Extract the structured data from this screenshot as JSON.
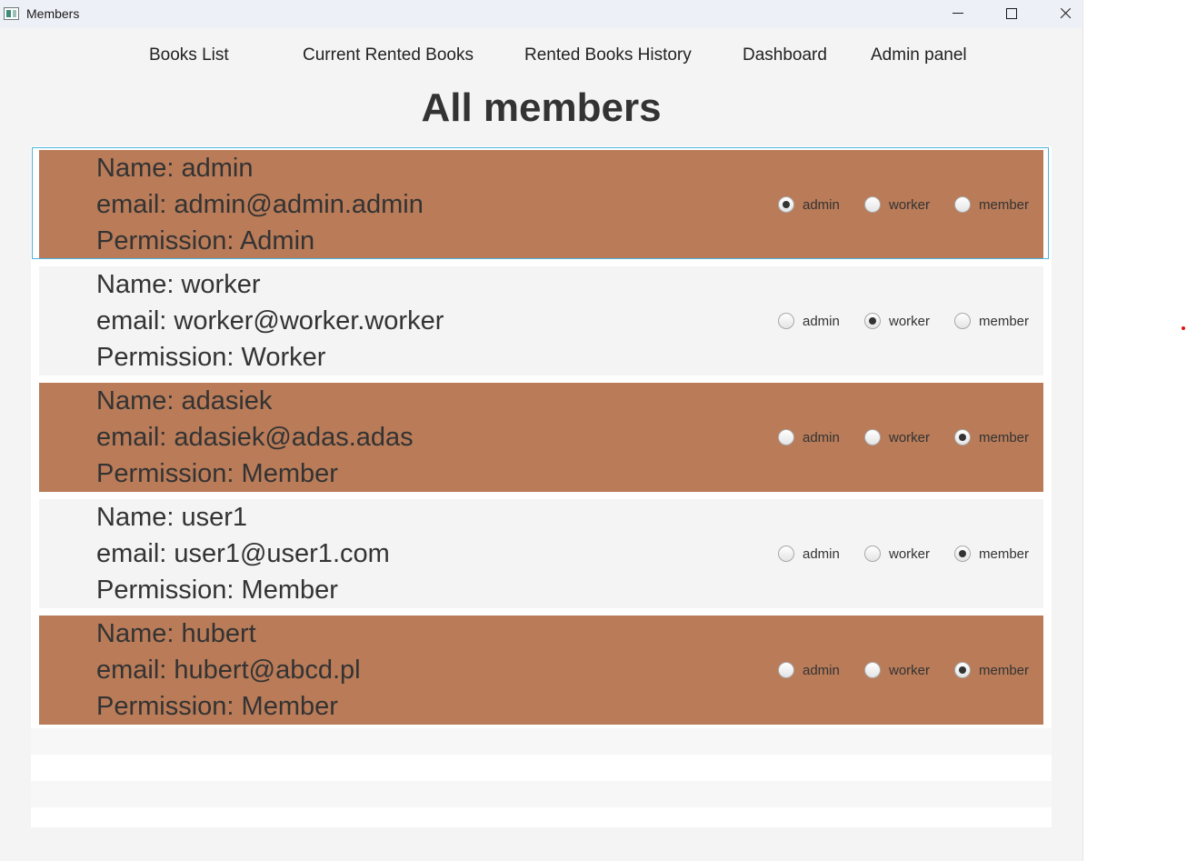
{
  "window": {
    "title": "Members"
  },
  "nav": {
    "items": [
      "Books List",
      "Current Rented Books",
      "Rented Books History",
      "Dashboard",
      "Admin panel"
    ]
  },
  "page": {
    "title": "All members"
  },
  "members": [
    {
      "name_line": "Name: admin",
      "email_line": " email: admin@admin.admin",
      "permission_line": "Permission: Admin",
      "role_options": [
        "admin",
        "worker",
        "member"
      ],
      "selected_role": "admin"
    },
    {
      "name_line": "Name: worker",
      "email_line": " email: worker@worker.worker",
      "permission_line": "Permission: Worker",
      "role_options": [
        "admin",
        "worker",
        "member"
      ],
      "selected_role": "worker"
    },
    {
      "name_line": "Name: adasiek",
      "email_line": " email: adasiek@adas.adas",
      "permission_line": "Permission: Member",
      "role_options": [
        "admin",
        "worker",
        "member"
      ],
      "selected_role": "member"
    },
    {
      "name_line": "Name: user1",
      "email_line": " email: user1@user1.com",
      "permission_line": "Permission: Member",
      "role_options": [
        "admin",
        "worker",
        "member"
      ],
      "selected_role": "member"
    },
    {
      "name_line": "Name: hubert",
      "email_line": " email: hubert@abcd.pl",
      "permission_line": "Permission: Member",
      "role_options": [
        "admin",
        "worker",
        "member"
      ],
      "selected_role": "member"
    }
  ],
  "colors": {
    "row_highlight": "#b97b58",
    "row_plain": "#f4f4f4",
    "focus_border": "#4cb5e0",
    "background": "#f4f4f4"
  }
}
